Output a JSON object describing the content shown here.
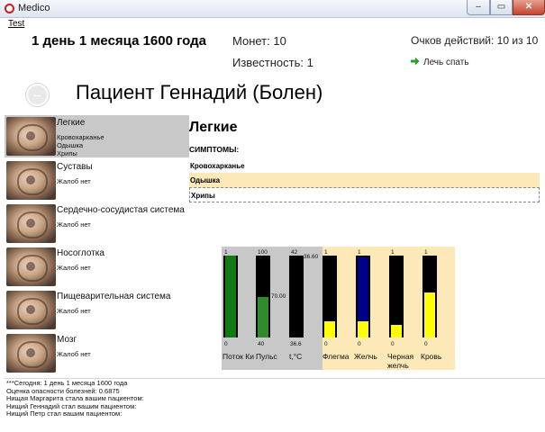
{
  "window": {
    "title": "Medico",
    "icon": "app-icon",
    "buttons": {
      "minimize": "–",
      "maximize": "▭",
      "close": "✕"
    }
  },
  "menu": {
    "items": [
      {
        "label": "Test"
      }
    ]
  },
  "header": {
    "date": "1 день 1 месяца 1600 года",
    "coins": "Монет: 10",
    "fame": "Известность: 1",
    "actions": "Очков действий: 10 из 10",
    "sleep": "Лечь спать",
    "sleep_icon": "green-arrow-icon",
    "patient": "Пациент Геннадий (Болен)",
    "back_icon": "back-arrow-icon",
    "back_glyph": "←"
  },
  "organs": [
    {
      "name": "Легкие",
      "symptoms": [
        "Кровохарканье",
        "Одышка",
        "Хрипы"
      ],
      "selected": true
    },
    {
      "name": "Суставы",
      "symptoms": [
        "Жалоб нет"
      ]
    },
    {
      "name": "Сердечно-сосудистая система",
      "symptoms": [
        "Жалоб нет"
      ]
    },
    {
      "name": "Носоглотка",
      "symptoms": [
        "Жалоб нет"
      ]
    },
    {
      "name": "Пищеварительная система",
      "symptoms": [
        "Жалоб нет"
      ]
    },
    {
      "name": "Мозг",
      "symptoms": [
        "Жалоб нет"
      ]
    }
  ],
  "details": {
    "title": "Легкие",
    "symptoms_label": "СИМПТОМЫ:",
    "symptoms": [
      {
        "text": "Кровохарканье",
        "highlight": false
      },
      {
        "text": "Одышка",
        "highlight": true
      },
      {
        "text": "Хрипы",
        "highlight": false,
        "focused": true
      }
    ]
  },
  "gauges": [
    {
      "label": "Поток Ки",
      "max": "1",
      "min": "0",
      "level": 1.0,
      "color": "#127a12",
      "group": "vitals"
    },
    {
      "label": "Пульс",
      "max": "100",
      "min": "40",
      "level": 0.5,
      "color": "#2e8b2e",
      "group": "vitals",
      "value_label": "70.00"
    },
    {
      "label": "t,°C",
      "max": "42",
      "min": "36.6",
      "level": 0.0,
      "color": "#000000",
      "group": "vitals",
      "value_label": "36.60"
    },
    {
      "label": "Флегма",
      "max": "1",
      "min": "0",
      "level": 0.2,
      "color": "#ffff00",
      "group": "humors"
    },
    {
      "label": "Желчь",
      "max": "1",
      "min": "0",
      "level": 0.2,
      "color": "#ffff00",
      "group": "humors",
      "base": "#00008b"
    },
    {
      "label": "Черная желчь",
      "max": "1",
      "min": "0",
      "level": 0.15,
      "color": "#ffff00",
      "group": "humors"
    },
    {
      "label": "Кровь",
      "max": "1",
      "min": "0",
      "level": 0.55,
      "color": "#ffff00",
      "group": "humors"
    }
  ],
  "log": [
    "***Сегодня: 1 день 1 месяца 1600 года",
    "Оценка опасности болезней: 0.6875",
    "Нищая Маргарита стала вашим пациентом:",
    "Нищий Геннадий стал вашим пациентом:",
    "Нищий Петр стал вашим пациентом:"
  ]
}
